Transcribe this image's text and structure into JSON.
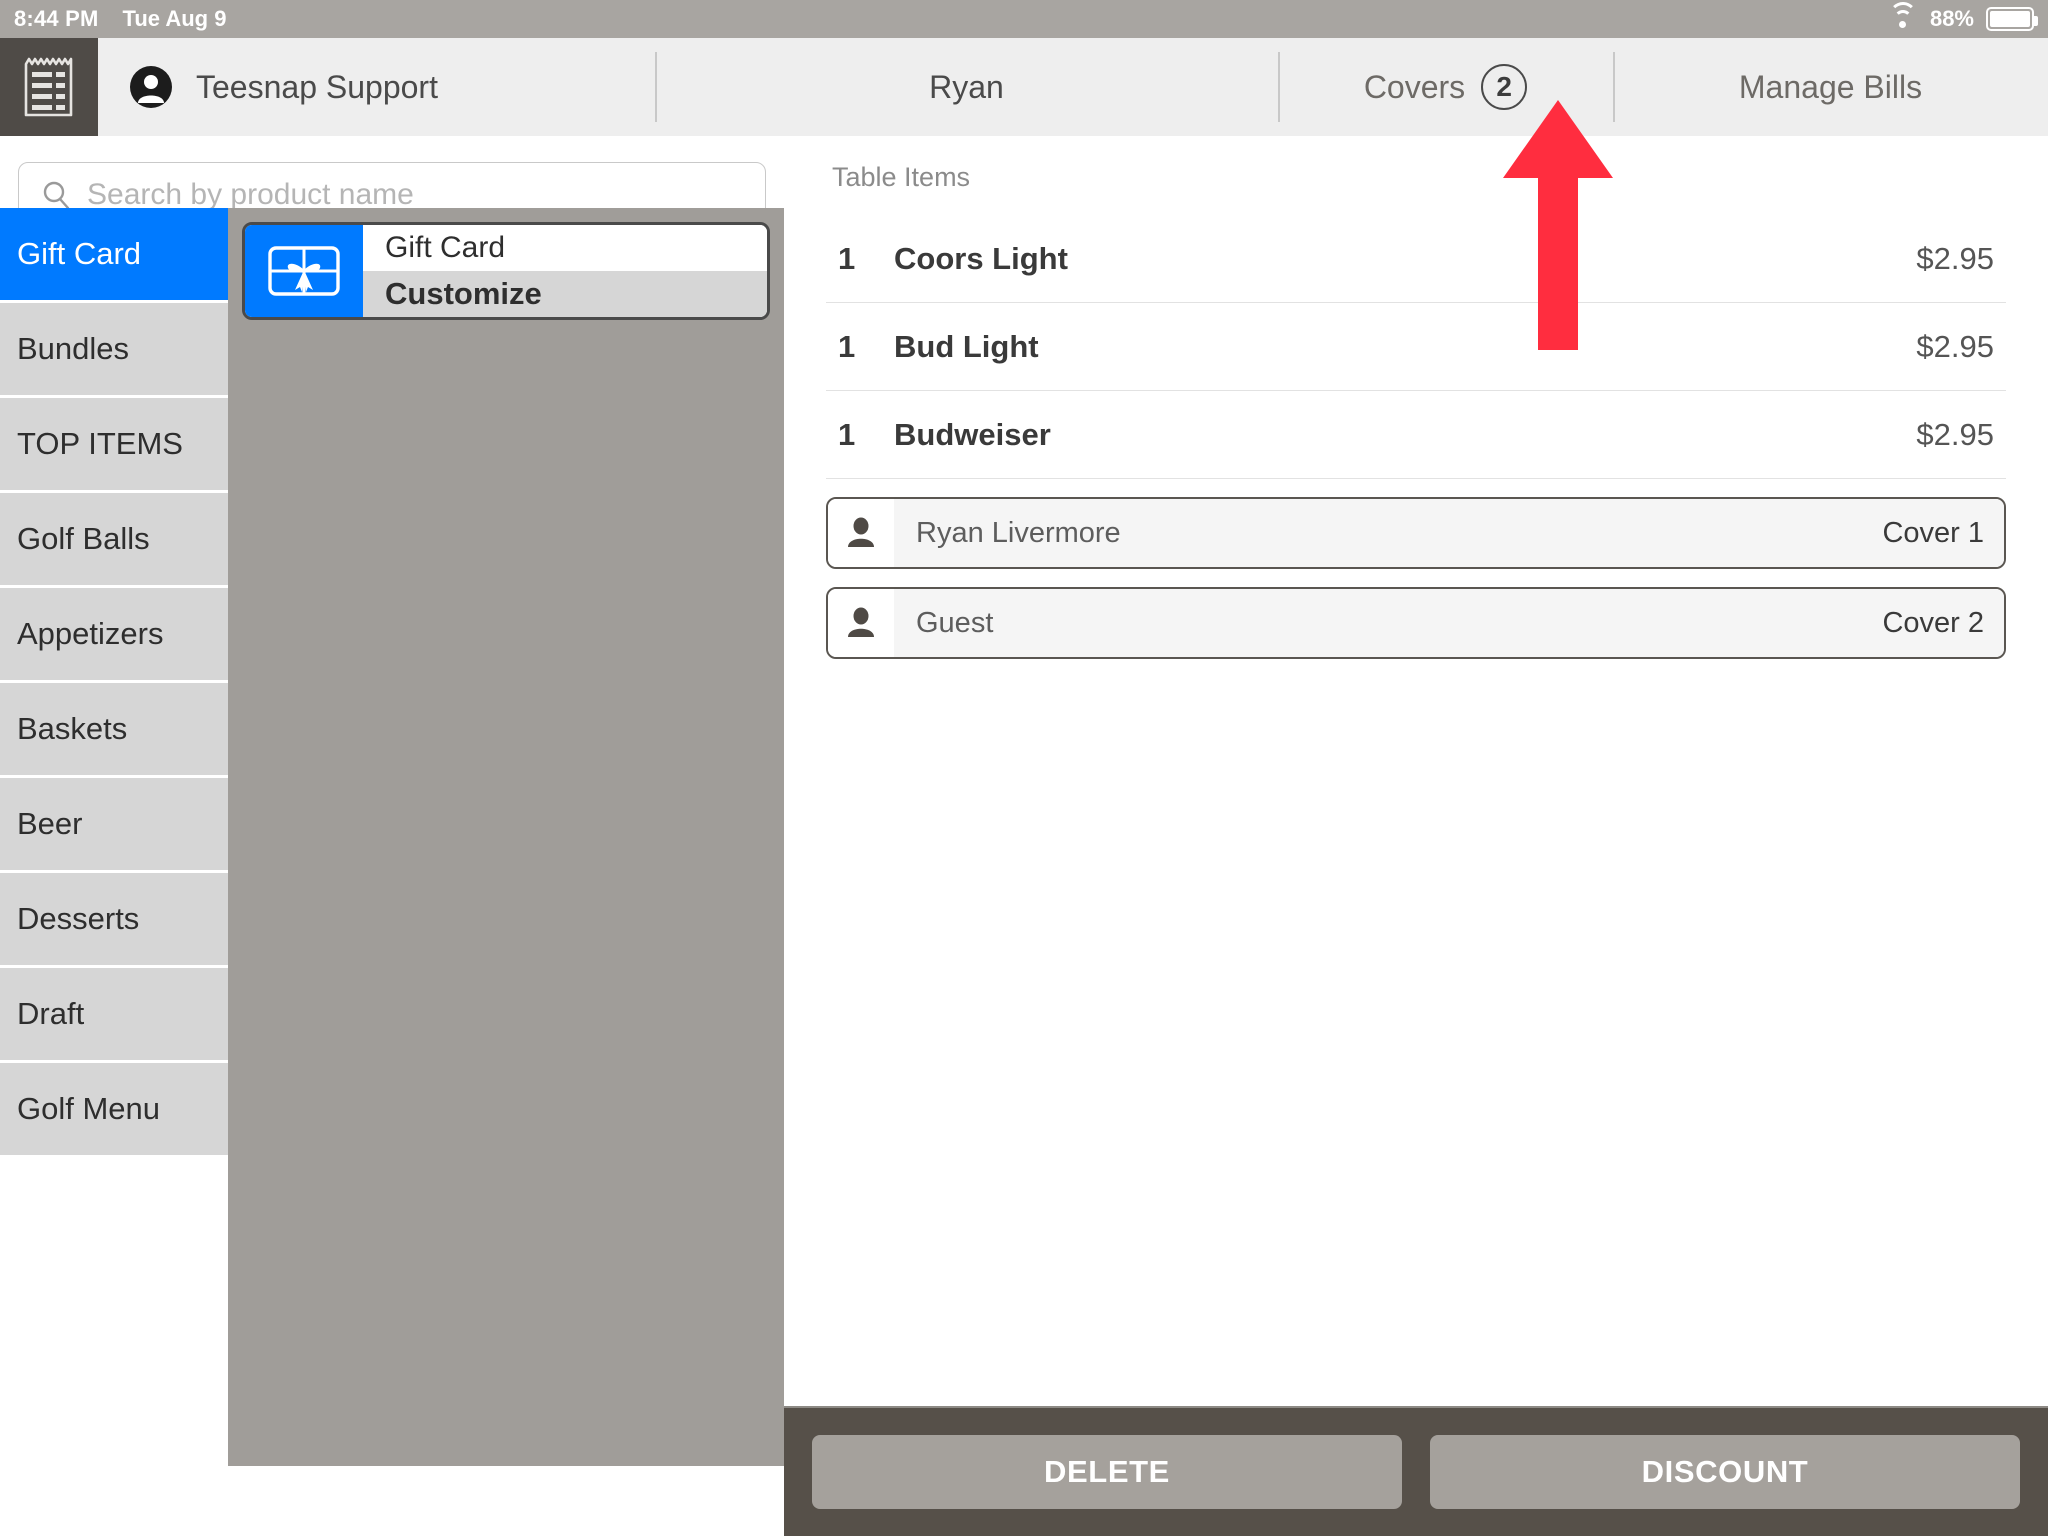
{
  "statusbar": {
    "time": "8:44 PM",
    "date": "Tue Aug 9",
    "battery_percent": "88%",
    "wifi_icon": "wifi-icon",
    "battery_icon": "battery-icon"
  },
  "topnav": {
    "ticket_icon": "receipt-icon",
    "avatar_icon": "person-circle-icon",
    "user_name": "Teesnap Support",
    "table_name": "Ryan",
    "covers_label": "Covers",
    "covers_count": "2",
    "manage_bills_label": "Manage Bills"
  },
  "search": {
    "placeholder": "Search by product name",
    "value": "",
    "icon": "search-icon"
  },
  "categories": [
    {
      "label": "Gift Card",
      "active": true
    },
    {
      "label": "Bundles",
      "active": false
    },
    {
      "label": "TOP ITEMS",
      "active": false
    },
    {
      "label": "Golf Balls",
      "active": false
    },
    {
      "label": "Appetizers",
      "active": false
    },
    {
      "label": "Baskets",
      "active": false
    },
    {
      "label": "Beer",
      "active": false
    },
    {
      "label": "Desserts",
      "active": false
    },
    {
      "label": "Draft",
      "active": false
    },
    {
      "label": "Golf Menu",
      "active": false
    }
  ],
  "product_tile": {
    "icon": "gift-card-icon",
    "title": "Gift Card",
    "action": "Customize"
  },
  "order": {
    "section_label": "Table Items",
    "items": [
      {
        "qty": "1",
        "name": "Coors Light",
        "price": "$2.95"
      },
      {
        "qty": "1",
        "name": "Bud Light",
        "price": "$2.95"
      },
      {
        "qty": "1",
        "name": "Budweiser",
        "price": "$2.95"
      }
    ],
    "covers": [
      {
        "icon": "person-icon",
        "name": "Ryan Livermore",
        "label": "Cover 1"
      },
      {
        "icon": "person-icon",
        "name": "Guest",
        "label": "Cover 2"
      }
    ]
  },
  "actions": {
    "delete_label": "DELETE",
    "discount_label": "DISCOUNT"
  },
  "annotation": {
    "arrow_icon": "up-arrow-annotation",
    "color": "#ff2d3f"
  },
  "colors": {
    "accent_blue": "#007aff",
    "sidebar_item": "#d6d6d6",
    "grid_background": "#a09d99",
    "action_bar": "#565049",
    "action_button": "#a5a19c"
  }
}
